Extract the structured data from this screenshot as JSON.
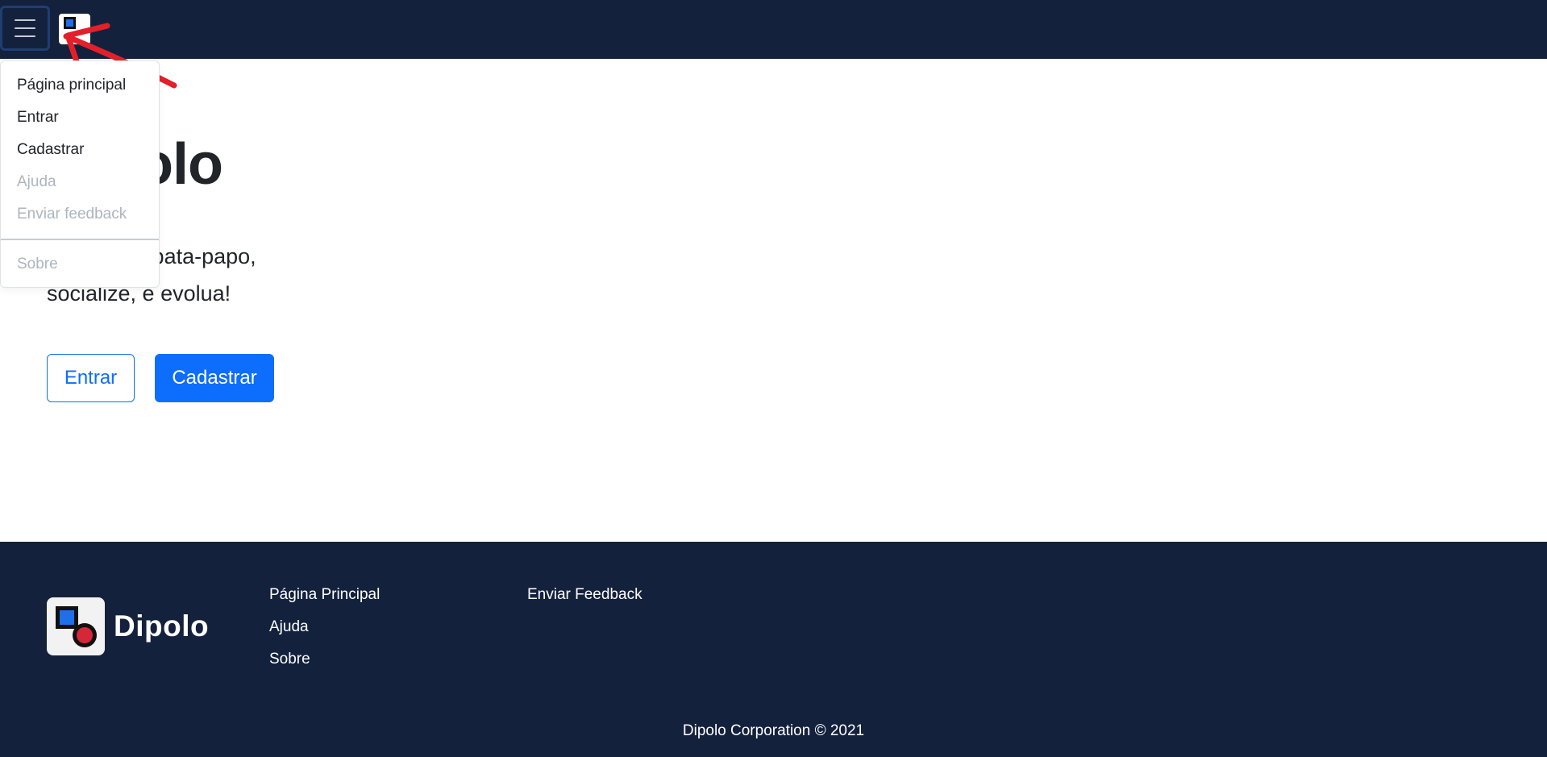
{
  "navbar": {
    "toggle_icon": "hamburger-menu-icon",
    "logo_icon": "dipolo-logo-icon",
    "colors": {
      "background": "#14213d"
    }
  },
  "dropdown": {
    "items": [
      {
        "label": "Página principal",
        "disabled": false
      },
      {
        "label": "Entrar",
        "disabled": false
      },
      {
        "label": "Cadastrar",
        "disabled": false
      },
      {
        "label": "Ajuda",
        "disabled": true
      },
      {
        "label": "Enviar feedback",
        "disabled": true
      }
    ],
    "after_divider": {
      "label": "Sobre",
      "disabled": true
    }
  },
  "hero": {
    "title": "Dipolo",
    "text": "Converse, bata-papo, socialize, e evolua!",
    "login_label": "Entrar",
    "signup_label": "Cadastrar"
  },
  "footer": {
    "brand": "Dipolo",
    "links_col1": [
      "Página Principal",
      "Ajuda",
      "Sobre"
    ],
    "links_col2": [
      "Enviar Feedback"
    ],
    "copyright": "Dipolo Corporation © 2021",
    "colors": {
      "background": "#14213d",
      "accent_blue": "#1e6fe8",
      "accent_red": "#d72638"
    }
  },
  "annotation": {
    "icon": "red-arrow-annotation",
    "color": "#e3202a"
  },
  "colors": {
    "primary": "#0d6efd"
  }
}
